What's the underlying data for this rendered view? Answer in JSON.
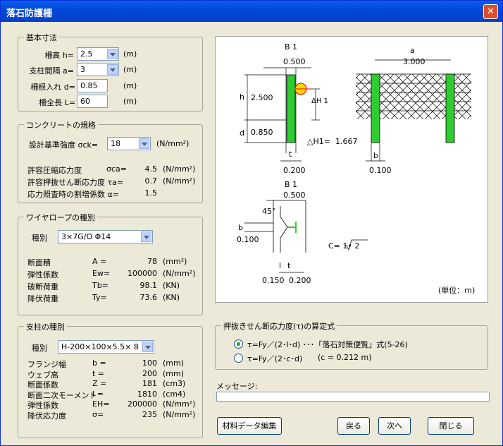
{
  "window": {
    "title": "落石防護柵",
    "close": "✕"
  },
  "basic": {
    "legend": "基本寸法",
    "rows": [
      {
        "label": "柵高 h=",
        "value": "2.5",
        "unit": "(m)"
      },
      {
        "label": "支柱間隔 a=",
        "value": "3",
        "unit": "(m)"
      },
      {
        "label": "柵根入れ d=",
        "value": "0.85",
        "unit": "(m)"
      },
      {
        "label": "柵全長 L=",
        "value": "60",
        "unit": "(m)"
      }
    ]
  },
  "concrete": {
    "legend": "コンクリートの規格",
    "strength_label": "設計基準強度 σck=",
    "strength_value": "18",
    "strength_unit": "(N/mm²)",
    "rows": [
      {
        "label": "許容圧縮応力度",
        "sym": "σca=",
        "value": "4.5",
        "unit": "(N/mm²)"
      },
      {
        "label": "許容押抜せん断応力度 τa=",
        "sym": "",
        "value": "0.7",
        "unit": "(N/mm²)"
      },
      {
        "label": "応力照査時の割増係数 α=",
        "sym": "",
        "value": "1.5",
        "unit": ""
      }
    ]
  },
  "wire": {
    "legend": "ワイヤロープの種別",
    "type_label": "種別",
    "type_value": "3×7G/O Φ14",
    "rows": [
      {
        "label": "断面積",
        "sym": "A =",
        "value": "78",
        "unit": "(mm²)"
      },
      {
        "label": "弾性係数",
        "sym": "Ew=",
        "value": "100000",
        "unit": "(N/mm²)"
      },
      {
        "label": "破断荷重",
        "sym": "Tb=",
        "value": "98.1",
        "unit": "(KN)"
      },
      {
        "label": "降伏荷重",
        "sym": "Ty=",
        "value": "73.6",
        "unit": "(KN)"
      }
    ]
  },
  "post": {
    "legend": "支柱の種別",
    "type_label": "種別",
    "type_value": "H-200×100×5.5× 8",
    "rows": [
      {
        "label": "フランジ幅",
        "sym": "b =",
        "value": "100",
        "unit": "(mm)"
      },
      {
        "label": "ウェブ高",
        "sym": "t =",
        "value": "200",
        "unit": "(mm)"
      },
      {
        "label": "断面係数",
        "sym": "Z =",
        "value": "181",
        "unit": "(cm3)"
      },
      {
        "label": "断面二次モーメント",
        "sym": "I =",
        "value": "1810",
        "unit": "(cm4)"
      },
      {
        "label": "弾性係数",
        "sym": "EH=",
        "value": "200000",
        "unit": "(N/mm²)"
      },
      {
        "label": "降伏応力度",
        "sym": "σ=",
        "value": "235",
        "unit": "(N/mm²)"
      }
    ]
  },
  "diagram": {
    "b1": "B 1",
    "b1_val": "0.500",
    "h": "h",
    "h_val": "2.500",
    "d": "d",
    "d_val": "0.850",
    "dh1": "ΔH 1",
    "dh1_eq": "△H1=",
    "dh1_val": "1.667",
    "t": "t",
    "t_val": "0.200",
    "a": "a",
    "a_val": "3.000",
    "b": "b",
    "b_val": "0.100",
    "b1_2": "B 1",
    "b1_2_val": "0.500",
    "angle": "45°",
    "b2": "b",
    "b2_val": "0.100",
    "c_formula": "C= 1• 2",
    "l": "l",
    "t2": "t",
    "l_val": "0.150",
    "t2_val": "0.200",
    "unit_note": "(単位：m)"
  },
  "formula": {
    "legend": "押抜きせん断応力度(τ)の算定式",
    "opt1": "τ=Fy／(2･l･d)  ･･･「落石対策便覧」式(5-26)",
    "opt2": "τ=Fy／(2･c･d)",
    "opt2_extra": "(c =  0.212  m)"
  },
  "message": {
    "label": "メッセージ:",
    "text": ""
  },
  "buttons": {
    "material": "材料データ編集",
    "back": "戻る",
    "next": "次へ",
    "close": "閉じる"
  }
}
